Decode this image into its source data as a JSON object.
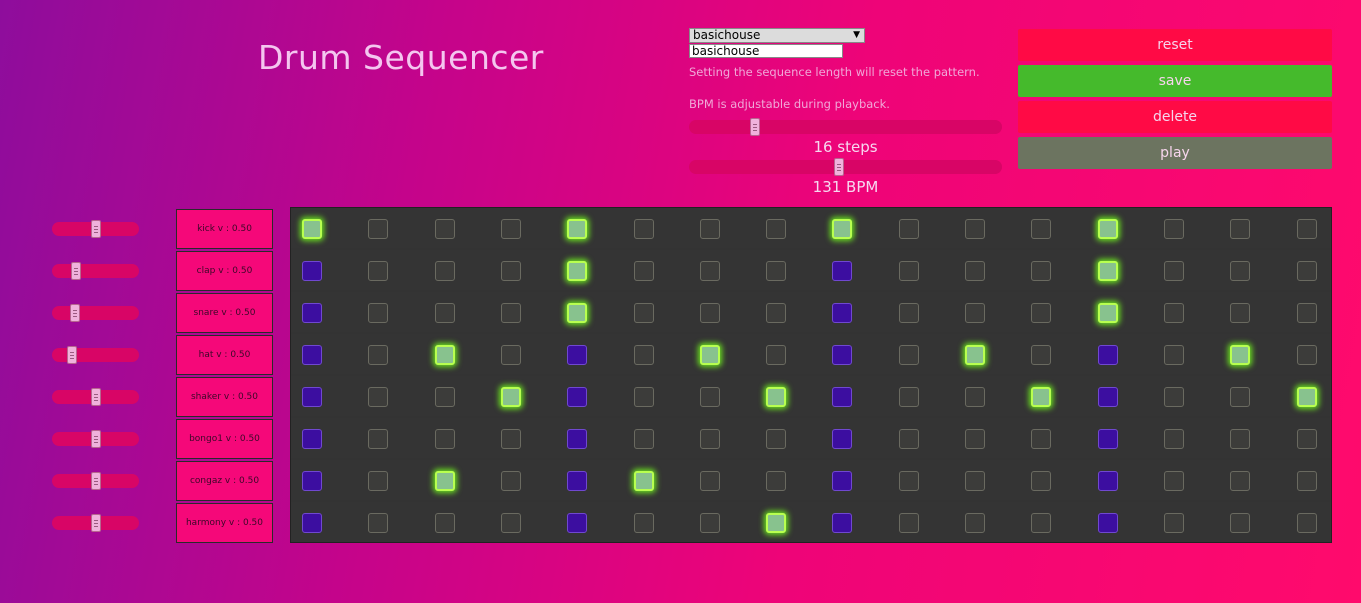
{
  "app": {
    "title": "Drum Sequencer"
  },
  "preset": {
    "selected": "basichouse",
    "name_value": "basichouse"
  },
  "notes": {
    "length_note": "Setting the sequence length will reset the pattern.",
    "bpm_note": "BPM is adjustable during playback."
  },
  "steps": {
    "value": 16,
    "label": "16 steps",
    "slider_fraction": 0.2
  },
  "bpm": {
    "value": 131,
    "label": "131 BPM",
    "slider_fraction": 0.48
  },
  "buttons": {
    "reset": "reset",
    "save": "save",
    "delete": "delete",
    "play": "play"
  },
  "colors": {
    "on": "#88c28e",
    "on_glow": "#b8ff50",
    "beat": "#3c0ea0",
    "off": "#3c3c3a",
    "reset": "#ff0a45",
    "save": "#45ba2c",
    "play": "#6c7460"
  },
  "tracks": [
    {
      "label": "kick v : 0.50",
      "volume_fraction": 0.5,
      "pattern": [
        1,
        0,
        0,
        0,
        1,
        0,
        0,
        0,
        1,
        0,
        0,
        0,
        1,
        0,
        0,
        0
      ]
    },
    {
      "label": "clap v : 0.50",
      "volume_fraction": 0.25,
      "pattern": [
        0,
        0,
        0,
        0,
        1,
        0,
        0,
        0,
        0,
        0,
        0,
        0,
        1,
        0,
        0,
        0
      ]
    },
    {
      "label": "snare v : 0.50",
      "volume_fraction": 0.24,
      "pattern": [
        0,
        0,
        0,
        0,
        1,
        0,
        0,
        0,
        0,
        0,
        0,
        0,
        1,
        0,
        0,
        0
      ]
    },
    {
      "label": "hat v : 0.50",
      "volume_fraction": 0.2,
      "pattern": [
        0,
        0,
        1,
        0,
        0,
        0,
        1,
        0,
        0,
        0,
        1,
        0,
        0,
        0,
        1,
        0
      ]
    },
    {
      "label": "shaker v : 0.50",
      "volume_fraction": 0.5,
      "pattern": [
        0,
        0,
        0,
        1,
        0,
        0,
        0,
        1,
        0,
        0,
        0,
        1,
        0,
        0,
        0,
        1
      ]
    },
    {
      "label": "bongo1 v : 0.50",
      "volume_fraction": 0.5,
      "pattern": [
        0,
        0,
        0,
        0,
        0,
        0,
        0,
        0,
        0,
        0,
        0,
        0,
        0,
        0,
        0,
        0
      ]
    },
    {
      "label": "congaz v : 0.50",
      "volume_fraction": 0.5,
      "pattern": [
        0,
        0,
        1,
        0,
        0,
        1,
        0,
        0,
        0,
        0,
        0,
        0,
        0,
        0,
        0,
        0
      ]
    },
    {
      "label": "harmony v : 0.50",
      "volume_fraction": 0.5,
      "pattern": [
        0,
        0,
        0,
        0,
        0,
        0,
        0,
        1,
        0,
        0,
        0,
        0,
        0,
        0,
        0,
        0
      ]
    }
  ]
}
